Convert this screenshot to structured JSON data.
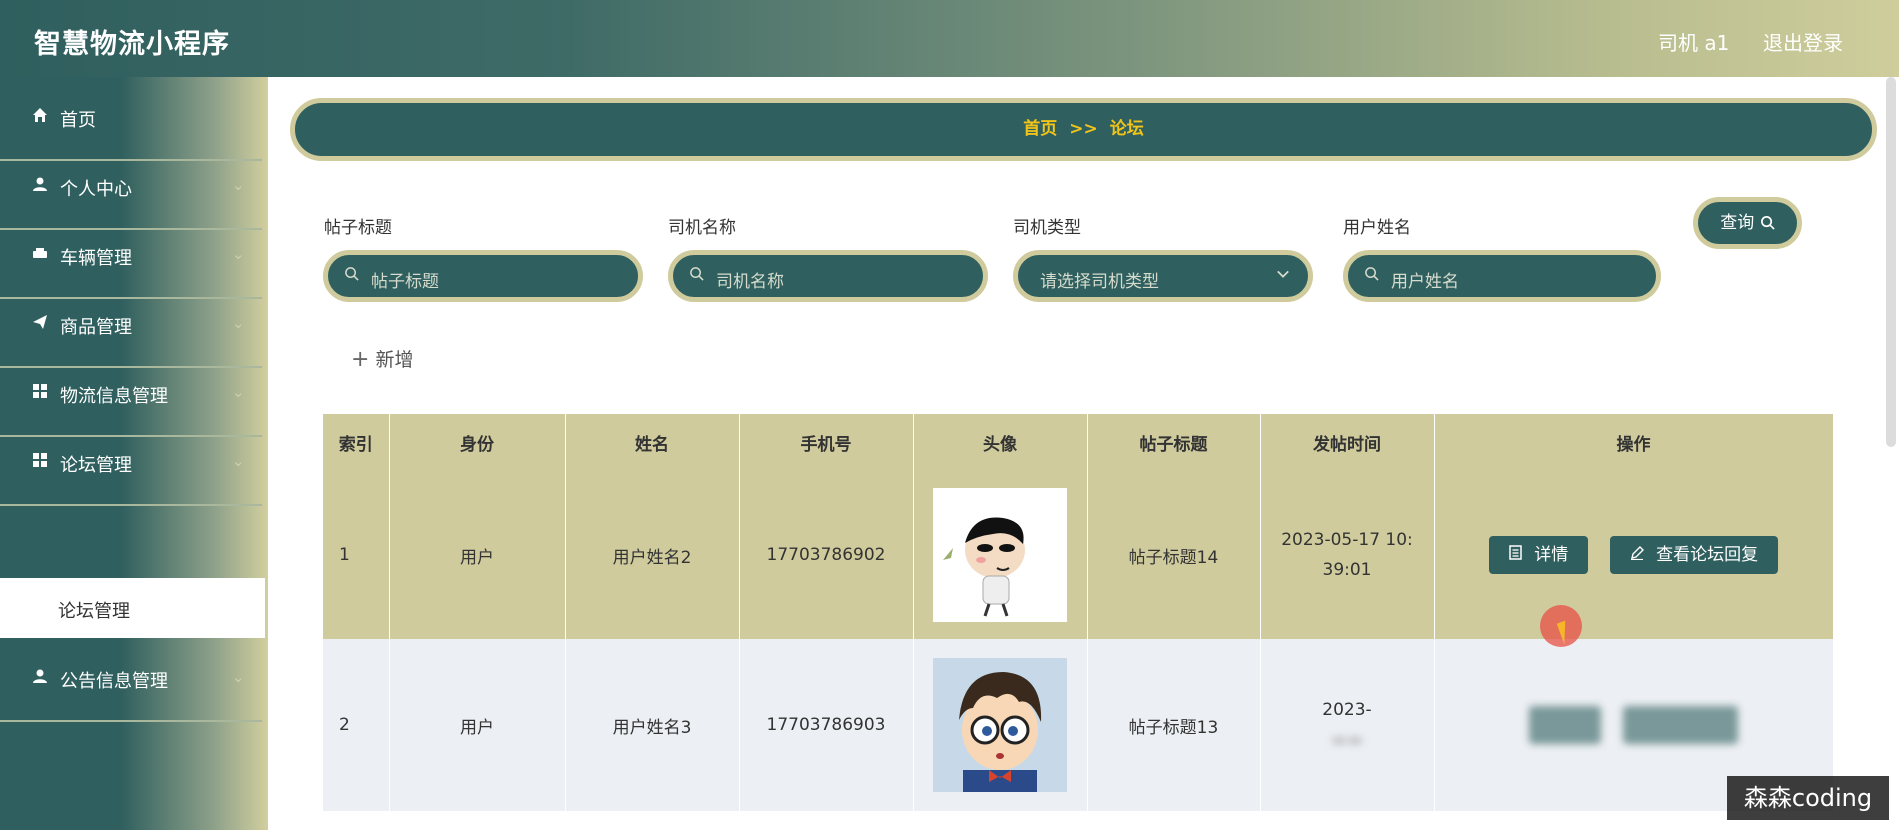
{
  "header": {
    "app_title": "智慧物流小程序",
    "user": "司机 a1",
    "logout": "退出登录"
  },
  "sidebar": {
    "items": [
      {
        "label": "首页",
        "icon": "home-icon"
      },
      {
        "label": "个人中心",
        "icon": "user-icon"
      },
      {
        "label": "车辆管理",
        "icon": "car-icon"
      },
      {
        "label": "商品管理",
        "icon": "send-icon"
      },
      {
        "label": "物流信息管理",
        "icon": "grid-icon"
      },
      {
        "label": "论坛管理",
        "icon": "grid-icon"
      },
      {
        "label": "公告信息管理",
        "icon": "user-icon"
      }
    ],
    "active_sub_item": "论坛管理"
  },
  "breadcrumb": {
    "home": "首页",
    "separator": ">>",
    "current": "论坛"
  },
  "filters": {
    "title_label": "帖子标题",
    "title_placeholder": "帖子标题",
    "driver_name_label": "司机名称",
    "driver_name_placeholder": "司机名称",
    "driver_type_label": "司机类型",
    "driver_type_placeholder": "请选择司机类型",
    "user_name_label": "用户姓名",
    "user_name_placeholder": "用户姓名",
    "query_button": "查询"
  },
  "toolbar": {
    "add_button": "新增"
  },
  "table": {
    "headers": [
      "索引",
      "身份",
      "姓名",
      "手机号",
      "头像",
      "帖子标题",
      "发帖时间",
      "操作"
    ],
    "rows": [
      {
        "index": "1",
        "identity": "用户",
        "name": "用户姓名2",
        "phone": "17703786902",
        "avatar": "avatar-image",
        "title": "帖子标题14",
        "time_line1": "2023-05-17 10:",
        "time_line2": "39:01",
        "detail_button": "详情",
        "replies_button": "查看论坛回复"
      },
      {
        "index": "2",
        "identity": "用户",
        "name": "用户姓名3",
        "phone": "17703786903",
        "avatar": "avatar-image",
        "title": "帖子标题13",
        "time_line1": "2023-"
      }
    ]
  },
  "watermark": "森森coding",
  "colors": {
    "primary": "#2f5f5e",
    "accent": "#cfcb9d",
    "breadcrumb_text": "#f0c419"
  }
}
